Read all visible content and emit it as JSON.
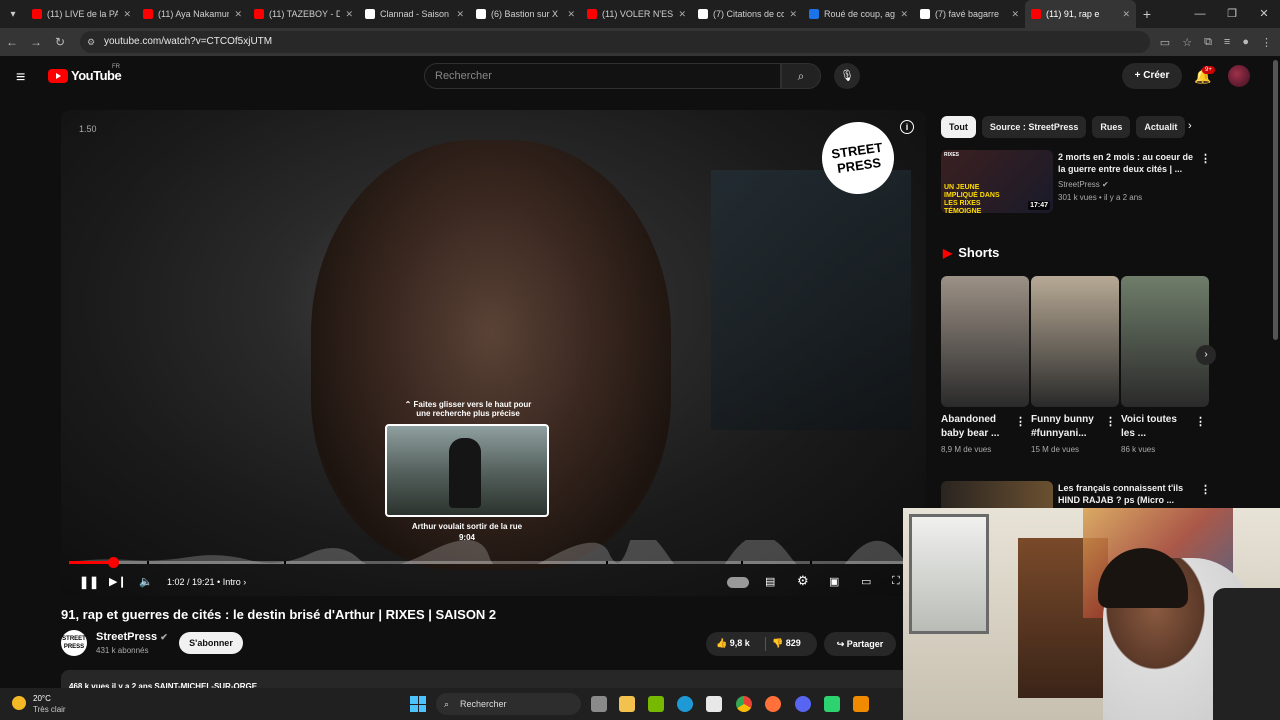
{
  "browser": {
    "tabs": [
      {
        "label": "(11) LIVE de la PA",
        "color": "#ff0000"
      },
      {
        "label": "(11) Aya Nakamura",
        "color": "#ff0000"
      },
      {
        "label": "(11) TAZEBOY - D",
        "color": "#ff0000"
      },
      {
        "label": "Clannad - Saison",
        "color": "#ffffff"
      },
      {
        "label": "(6) Bastion sur X",
        "color": "#ffffff"
      },
      {
        "label": "(11) VOLER N'EST",
        "color": "#ff0000"
      },
      {
        "label": "(7) Citations de co",
        "color": "#ffffff"
      },
      {
        "label": "Roué de coup, ag",
        "color": "#1a73e8"
      },
      {
        "label": "(7) favé bagarre",
        "color": "#ffffff"
      },
      {
        "label": "(11) 91, rap e",
        "color": "#ff0000"
      }
    ],
    "url": "youtube.com/watch?v=CTCOf5xjUTM"
  },
  "header": {
    "logo_text": "YouTube",
    "country": "FR",
    "search_placeholder": "Rechercher",
    "create_label": "Créer",
    "notification_badge": "9+"
  },
  "player": {
    "overlay_timer": "1.50",
    "brand_logo": "STREET PRESS",
    "hint": "Faites glisser vers le haut pour une recherche plus précise",
    "preview_title": "Arthur voulait sortir de la rue",
    "preview_time": "9:04",
    "time": "1:02 / 19:21",
    "chapter": "Intro",
    "progress_played": 0.053,
    "hover_position": 0.468,
    "chapter_marks": [
      0.093,
      0.257,
      0.643,
      0.805,
      0.888
    ]
  },
  "video": {
    "title": "91, rap et guerres de cités : le destin brisé d'Arthur | RIXES | SAISON 2",
    "channel": "StreetPress",
    "channel_avatar_text": "STREET PRESS",
    "subscribers": "431 k abonnés",
    "subscribe_label": "S'abonner",
    "likes": "9,8 k",
    "dislikes": "829",
    "share_label": "Partager",
    "description_peek": "468 k vues  il y a 2 ans  SAINT-MICHEL-SUR-ORGE"
  },
  "sidebar": {
    "chips": [
      "Tout",
      "Source : StreetPress",
      "Rues",
      "Actualit"
    ],
    "rec1": {
      "tag": "RIXES",
      "thumb_text": "UN JEUNE IMPLIQUÉ DANS LES RIXES TÉMOIGNE",
      "duration": "17:47",
      "title": "2 morts en 2 mois : au coeur de la guerre entre deux cités | ...",
      "channel": "StreetPress",
      "meta": "301 k vues • il y a 2 ans"
    },
    "shorts_title": "Shorts",
    "shorts": [
      {
        "title": "Abandoned baby bear ...",
        "views": "8,9 M de vues",
        "bg": "#9c9186"
      },
      {
        "title": "Funny bunny #funnyani...",
        "views": "15 M de vues",
        "bg": "#b7a995"
      },
      {
        "title": "Voici toutes les ...",
        "views": "86 k vues",
        "bg": "#6f7d6a"
      }
    ],
    "rec2": {
      "title": "Les français connaissent t'ils HIND RAJAB ? ps (Micro ..."
    }
  },
  "taskbar": {
    "temperature": "20°C",
    "condition": "Très clair",
    "search_label": "Rechercher"
  }
}
